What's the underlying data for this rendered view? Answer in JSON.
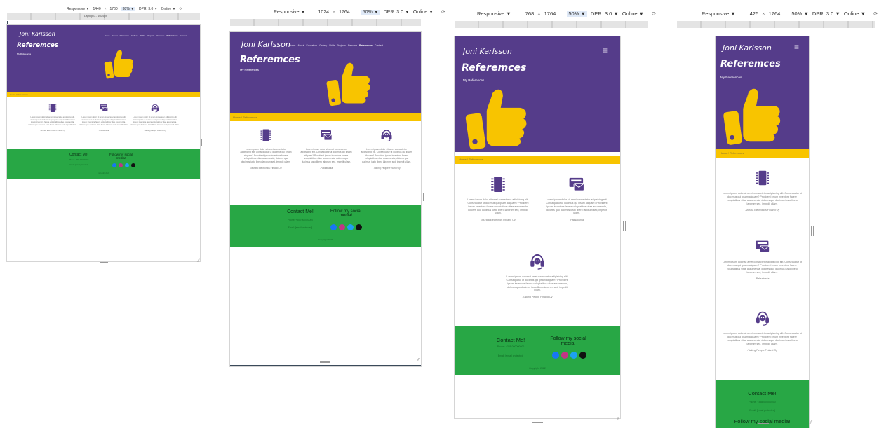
{
  "site": {
    "brand": "Joni Karlsson",
    "title": "Referemces",
    "subtitle": "My References",
    "nav": [
      "Home",
      "About",
      "Education",
      "Gallery",
      "Skills",
      "Projects",
      "Resume",
      "References",
      "Contact"
    ],
    "nav_active": "References",
    "breadcrumb": "Home / References",
    "body_text": "Lorem ipsum dolor sit amet consectetur adipisicing elit. Consequatur ut ducimus qui ipsam aliquam? Provident ipsum inventore facere voluptatibus vitae assumenda, dolores quo ducimus iusto libero laborum sed, impedit ullam.",
    "references": [
      {
        "icon": "chip-icon",
        "name": "-Murata Electronics Finland Oy"
      },
      {
        "icon": "mailbox-icon",
        "name": "-Paksakunta"
      },
      {
        "icon": "headset-icon",
        "name": "-Talking People Finland Oy"
      }
    ],
    "contact_heading": "Contact Me!",
    "phone": "Phone: +358 000000000",
    "email": "Email: [email protected]",
    "social_heading": "Follow my social media!",
    "copyright": "Copyright 2022"
  },
  "toolbars": [
    {
      "device": "Responsive",
      "width": "1440",
      "height": "1760",
      "zoom": "38%",
      "dpr": "DPR: 3.0",
      "network": "Online",
      "subtitle": "Laptop L - 1024px"
    },
    {
      "device": "Responsive",
      "width": "1024",
      "height": "1764",
      "zoom": "50%",
      "dpr": "DPR: 3.0",
      "network": "Online"
    },
    {
      "device": "Responsive",
      "width": "768",
      "height": "1764",
      "zoom": "50%",
      "dpr": "DPR: 3.0",
      "network": "Online"
    },
    {
      "device": "Responsive",
      "width": "425",
      "height": "1764",
      "zoom": "50%",
      "dpr": "DPR: 3.0",
      "network": "Online"
    }
  ],
  "ui": {
    "multiply": "×",
    "dropdown": "▼",
    "rotate": "⟳",
    "hamburger": "≡",
    "resize": "⁄⁄",
    "handle": "⋮"
  },
  "colors": {
    "purple": "#553c8a",
    "yellow": "#f8c400",
    "green": "#28a745",
    "icon": "#553c8a"
  }
}
